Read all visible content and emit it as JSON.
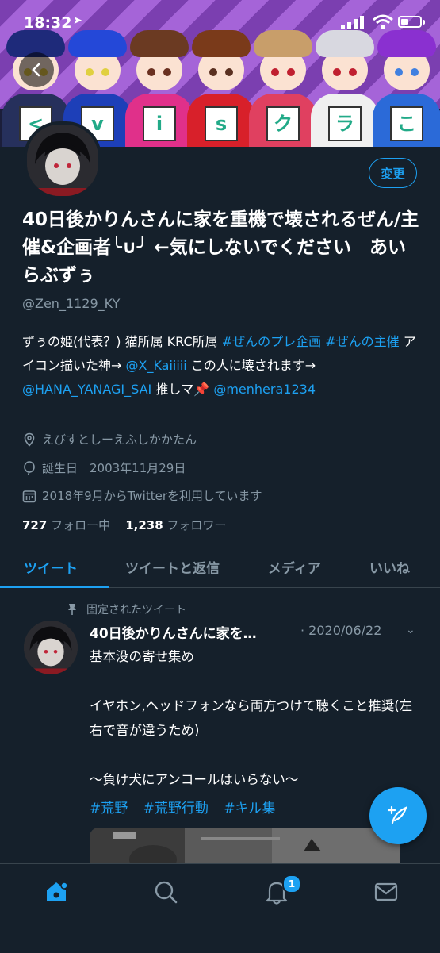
{
  "status_bar": {
    "time": "18:32"
  },
  "banner": {
    "card_letters": [
      "<",
      "v",
      "i",
      "s",
      "ク",
      "ラ",
      "こ"
    ]
  },
  "profile": {
    "edit_label": "変更",
    "display_name": "40日後かりんさんに家を重機で壊されるぜん/主催&企画者╰∪╯ ←気にしないでください　あいらぶずぅ",
    "handle": "@Zen_1129_KY",
    "bio": {
      "t1": "ずぅの姫(代表？) 猫所属 KRC所属 ",
      "h1": "#ぜんのプレ企画",
      "t2": " ",
      "h2": "#ぜんの主催",
      "t3": " アイコン描いた神→ ",
      "m1": "@X_Kaiiiii",
      "t4": " この人に壊されます→ ",
      "m2": "@HANA_YANAGI_SAI",
      "t5": " 推しマ📌 ",
      "m3": "@menhera1234"
    },
    "location": "えびすとしーえふしかかたん",
    "birthday": "誕生日　2003年11月29日",
    "joined": "2018年9月からTwitterを利用しています",
    "following_count": "727",
    "following_label": "フォロー中",
    "followers_count": "1,238",
    "followers_label": "フォロワー"
  },
  "tabs": [
    "ツイート",
    "ツイートと返信",
    "メディア",
    "いいね"
  ],
  "pinned_tweet": {
    "pinned_label": "固定されたツイート",
    "author": "40日後かりんさんに家を…",
    "date": "· 2020/06/22",
    "lines": [
      "基本没の寄せ集め",
      "",
      "イヤホン,ヘッドフォンなら両方つけて聴くこと推奨(左右で音が違うため)",
      "",
      "〜負け犬にアンコールはいらない〜"
    ],
    "hashtags": [
      "#荒野",
      "#荒野行動",
      "#キル集"
    ]
  },
  "bottom_nav": {
    "notification_count": "1"
  },
  "colors": {
    "background": "#15202b",
    "accent": "#1da1f2",
    "secondary_text": "#8899a6",
    "border": "#38444d"
  }
}
